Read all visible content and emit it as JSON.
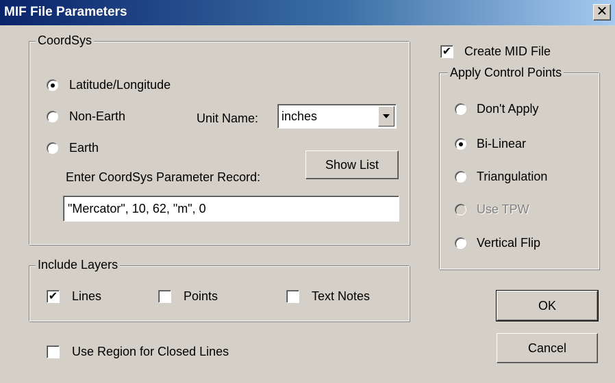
{
  "window": {
    "title": "MIF File Parameters",
    "close_glyph": "✕"
  },
  "coordsys": {
    "label": "CoordSys",
    "options": [
      "Latitude/Longitude",
      "Non-Earth",
      "Earth"
    ],
    "selected": "Latitude/Longitude",
    "unit_name_label": "Unit Name:",
    "unit_name_value": "inches",
    "show_list_label": "Show List",
    "param_label": "Enter CoordSys Parameter Record:",
    "param_value": "\"Mercator\", 10, 62, \"m\", 0"
  },
  "include_layers": {
    "label": "Include Layers",
    "items": [
      {
        "label": "Lines",
        "checked": true
      },
      {
        "label": "Points",
        "checked": false
      },
      {
        "label": "Text Notes",
        "checked": false
      }
    ]
  },
  "use_region": {
    "label": "Use Region for Closed Lines",
    "checked": false
  },
  "create_mid": {
    "label": "Create MID File",
    "checked": true
  },
  "control_points": {
    "label": "Apply Control Points",
    "options": [
      "Don't Apply",
      "Bi-Linear",
      "Triangulation",
      "Use TPW",
      "Vertical Flip"
    ],
    "selected": "Bi-Linear",
    "disabled": [
      "Use TPW"
    ]
  },
  "buttons": {
    "ok": "OK",
    "cancel": "Cancel"
  },
  "check_glyph": "✔"
}
